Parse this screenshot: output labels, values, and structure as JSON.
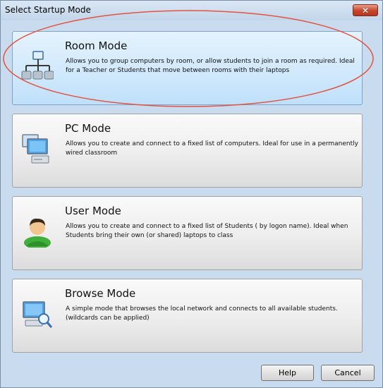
{
  "window": {
    "title": "Select Startup Mode",
    "close_symbol": "✕"
  },
  "modes": [
    {
      "title": "Room Mode",
      "description": "Allows you to group computers by room, or allow students to join a room as required. Ideal for a Teacher or Students that move between rooms with their laptops",
      "icon": "network-hierarchy-icon",
      "selected": true
    },
    {
      "title": "PC Mode",
      "description": "Allows you to create and connect to a fixed list of computers. Ideal for use in a permanently wired classroom",
      "icon": "computers-icon",
      "selected": false
    },
    {
      "title": "User Mode",
      "description": "Allows you to create and connect to a fixed list of Students ( by logon name). Ideal when Students bring their own (or shared) laptops to class",
      "icon": "user-icon",
      "selected": false
    },
    {
      "title": "Browse Mode",
      "description": "A simple mode that browses the local network and connects to all available students. (wildcards can be applied)",
      "icon": "browse-computer-icon",
      "selected": false
    }
  ],
  "buttons": {
    "help": "Help",
    "cancel": "Cancel"
  },
  "colors": {
    "highlight_ellipse": "#e4533f",
    "selected_card": "#cfe8fb"
  }
}
